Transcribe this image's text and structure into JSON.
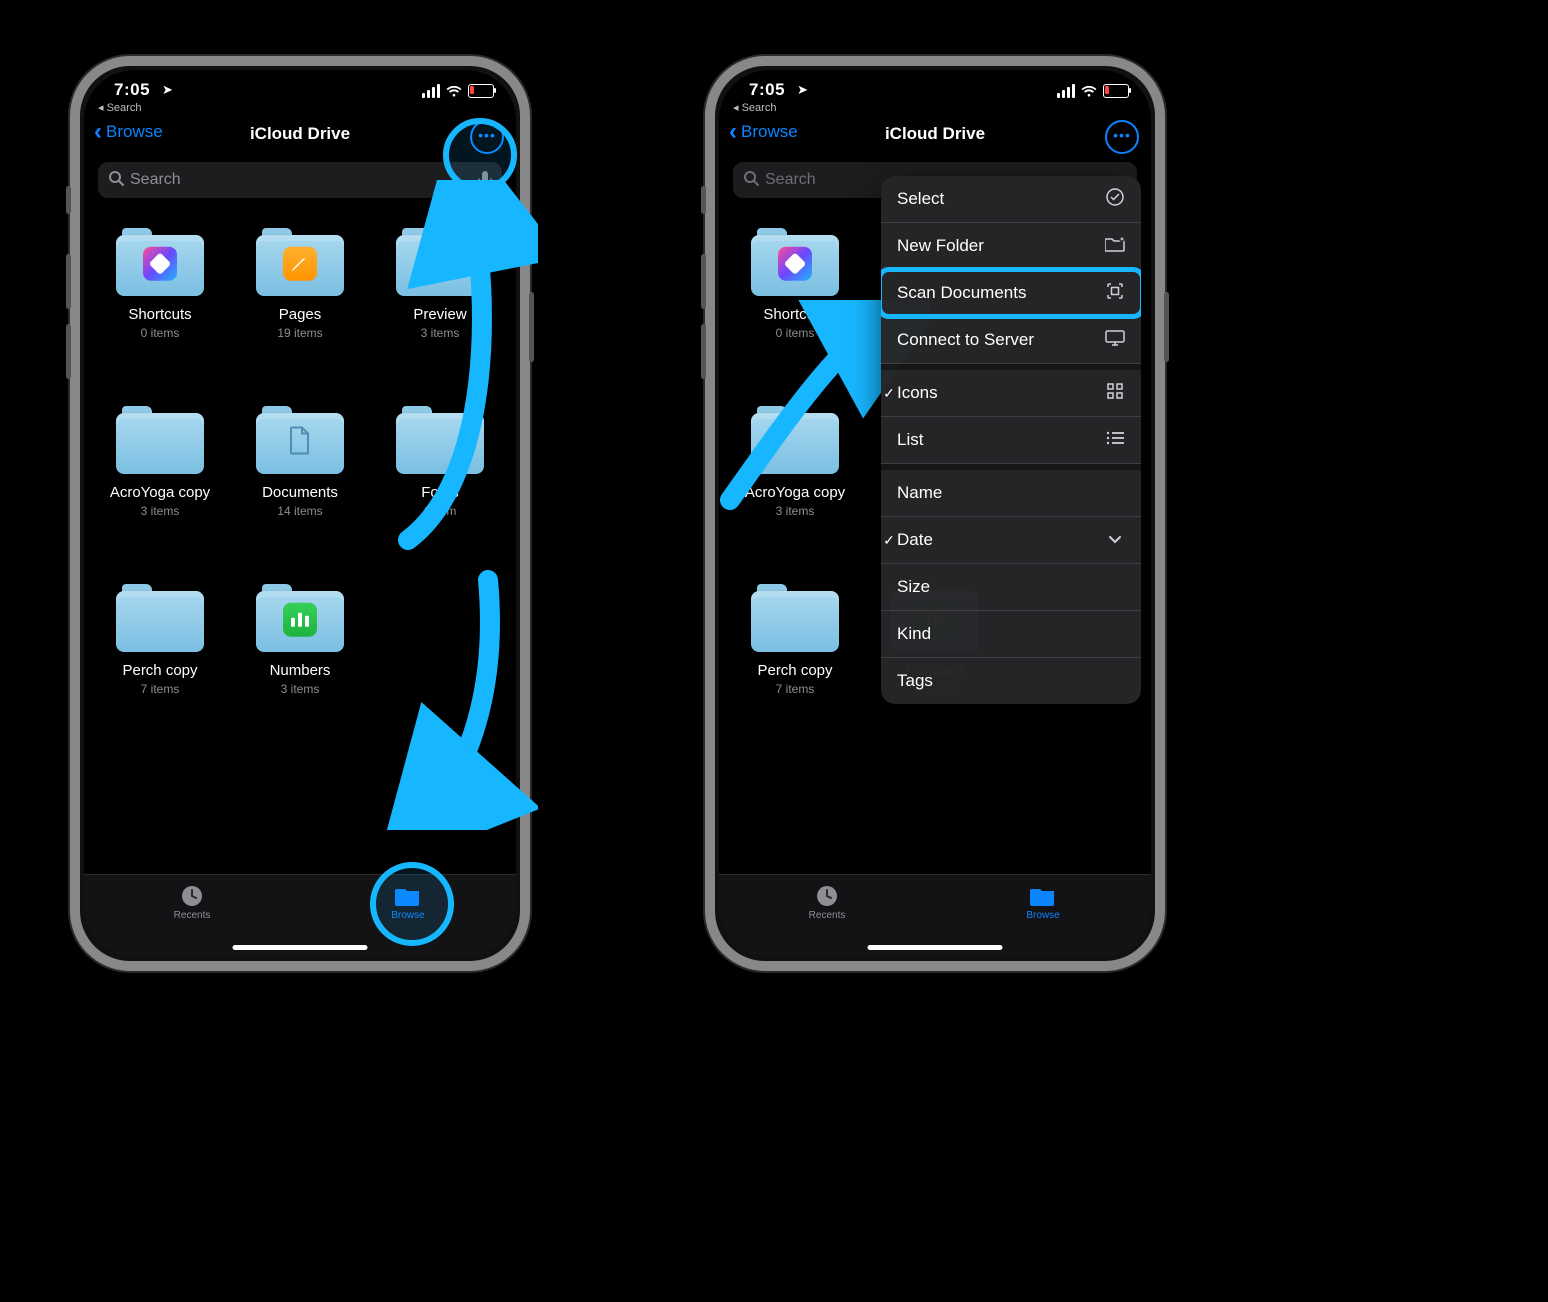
{
  "status": {
    "time": "7:05",
    "backApp": "◂ Search"
  },
  "nav": {
    "backLabel": "Browse",
    "title": "iCloud Drive"
  },
  "search": {
    "placeholder": "Search"
  },
  "folders": [
    {
      "name": "Shortcuts",
      "meta": "0 items",
      "icon": "shortcuts"
    },
    {
      "name": "Pages",
      "meta": "19 items",
      "icon": "pages"
    },
    {
      "name": "Preview",
      "meta": "3 items",
      "icon": "plain"
    },
    {
      "name": "AcroYoga copy",
      "meta": "3 items",
      "icon": "plain"
    },
    {
      "name": "Documents",
      "meta": "14 items",
      "icon": "doc"
    },
    {
      "name": "Fonts",
      "meta": "1 item",
      "icon": "plain"
    },
    {
      "name": "Perch copy",
      "meta": "7 items",
      "icon": "plain"
    },
    {
      "name": "Numbers",
      "meta": "3 items",
      "icon": "numbers"
    }
  ],
  "foldersRight": [
    {
      "name": "Shortcuts",
      "meta": "0 items",
      "icon": "shortcuts"
    },
    {
      "name": "AcroYoga copy",
      "meta": "3 items",
      "icon": "plain"
    },
    {
      "name": "Perch copy",
      "meta": "7 items",
      "icon": "plain"
    },
    {
      "name": "Numbers",
      "meta": "3 items",
      "icon": "numbers"
    }
  ],
  "tabs": {
    "recents": "Recents",
    "browse": "Browse"
  },
  "menu": {
    "select": "Select",
    "newFolder": "New Folder",
    "scan": "Scan Documents",
    "connect": "Connect to Server",
    "icons": "Icons",
    "list": "List",
    "name": "Name",
    "date": "Date",
    "size": "Size",
    "kind": "Kind",
    "tags": "Tags"
  },
  "tutorial_step": "Tap Browse tab, tap more (…) button, choose Scan Documents"
}
